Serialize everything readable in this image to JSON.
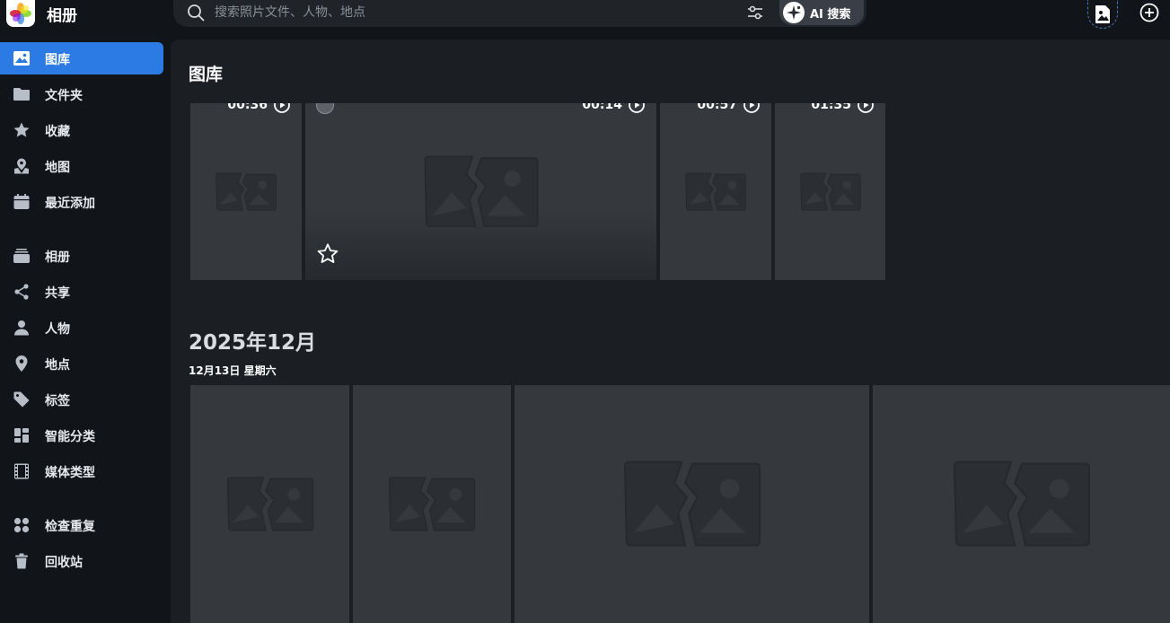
{
  "app": {
    "title": "相册"
  },
  "search": {
    "placeholder": "搜索照片文件、人物、地点",
    "ai_label": "AI 搜索"
  },
  "sidebar": {
    "items": [
      {
        "label": "图库",
        "icon": "image-icon",
        "active": true
      },
      {
        "label": "文件夹",
        "icon": "folder-icon"
      },
      {
        "label": "收藏",
        "icon": "star-icon"
      },
      {
        "label": "地图",
        "icon": "map-pin-icon"
      },
      {
        "label": "最近添加",
        "icon": "calendar-icon"
      },
      {
        "label": "相册",
        "icon": "album-stack-icon"
      },
      {
        "label": "共享",
        "icon": "share-icon"
      },
      {
        "label": "人物",
        "icon": "person-icon"
      },
      {
        "label": "地点",
        "icon": "location-icon"
      },
      {
        "label": "标签",
        "icon": "tag-icon"
      },
      {
        "label": "智能分类",
        "icon": "grid-icon"
      },
      {
        "label": "媒体类型",
        "icon": "film-icon"
      },
      {
        "label": "检查重复",
        "icon": "duplicate-icon"
      },
      {
        "label": "回收站",
        "icon": "trash-icon"
      }
    ]
  },
  "main": {
    "title": "图库",
    "videos": [
      {
        "duration": "00:36"
      },
      {
        "duration": "00:14"
      },
      {
        "duration": "00:57"
      },
      {
        "duration": "01:35"
      }
    ],
    "month": "2025年12月",
    "date": "12月13日 星期六"
  },
  "colors": {
    "accent": "#2c7be5",
    "background": "#111418",
    "panel": "#1b1e23",
    "tile": "#35383d"
  }
}
